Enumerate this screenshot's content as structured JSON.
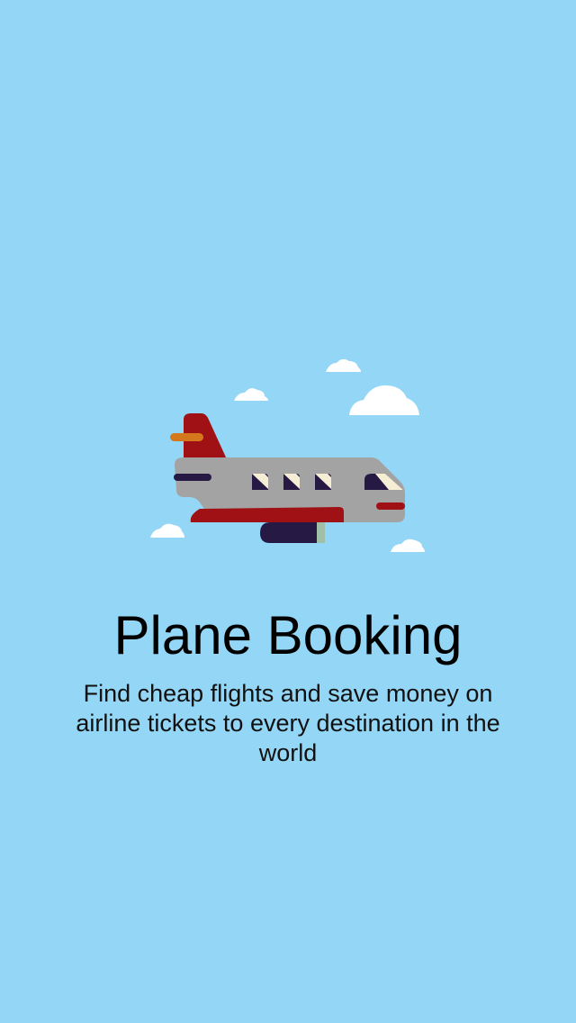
{
  "splash": {
    "title": "Plane Booking",
    "subtitle": "Find cheap flights and save money on airline tickets to every destination in the world"
  },
  "illustration": {
    "icon": "airplane-illustration",
    "cloud_icon": "cloud-icon"
  },
  "colors": {
    "background": "#93d6f5",
    "fuselage": "#a3a3a3",
    "tail": "#a01115",
    "stripe": "#a01115",
    "navy": "#261a45",
    "window_light": "#f5eed4",
    "orange": "#d5781d",
    "cloud": "#ffffff",
    "text": "#000000"
  }
}
